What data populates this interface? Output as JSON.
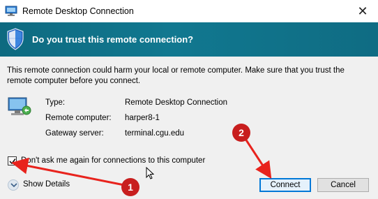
{
  "window": {
    "title": "Remote Desktop Connection",
    "close_glyph": "✕"
  },
  "banner": {
    "heading": "Do you trust this remote connection?"
  },
  "warning": {
    "text": "This remote connection could harm your local or remote computer. Make sure that you trust the remote computer before you connect."
  },
  "details": [
    {
      "label": "Type:",
      "value": "Remote Desktop Connection"
    },
    {
      "label": "Remote computer:",
      "value": "harper8-1"
    },
    {
      "label": "Gateway server:",
      "value": "terminal.cgu.edu"
    }
  ],
  "checkbox": {
    "label": "Don't ask me again for connections to this computer",
    "checked": true
  },
  "show_details": {
    "label": "Show Details"
  },
  "buttons": {
    "connect": "Connect",
    "cancel": "Cancel"
  },
  "annotations": {
    "marker_1": "1",
    "marker_2": "2",
    "color": "#e8231d",
    "marker_fill": "#c81e1e"
  }
}
